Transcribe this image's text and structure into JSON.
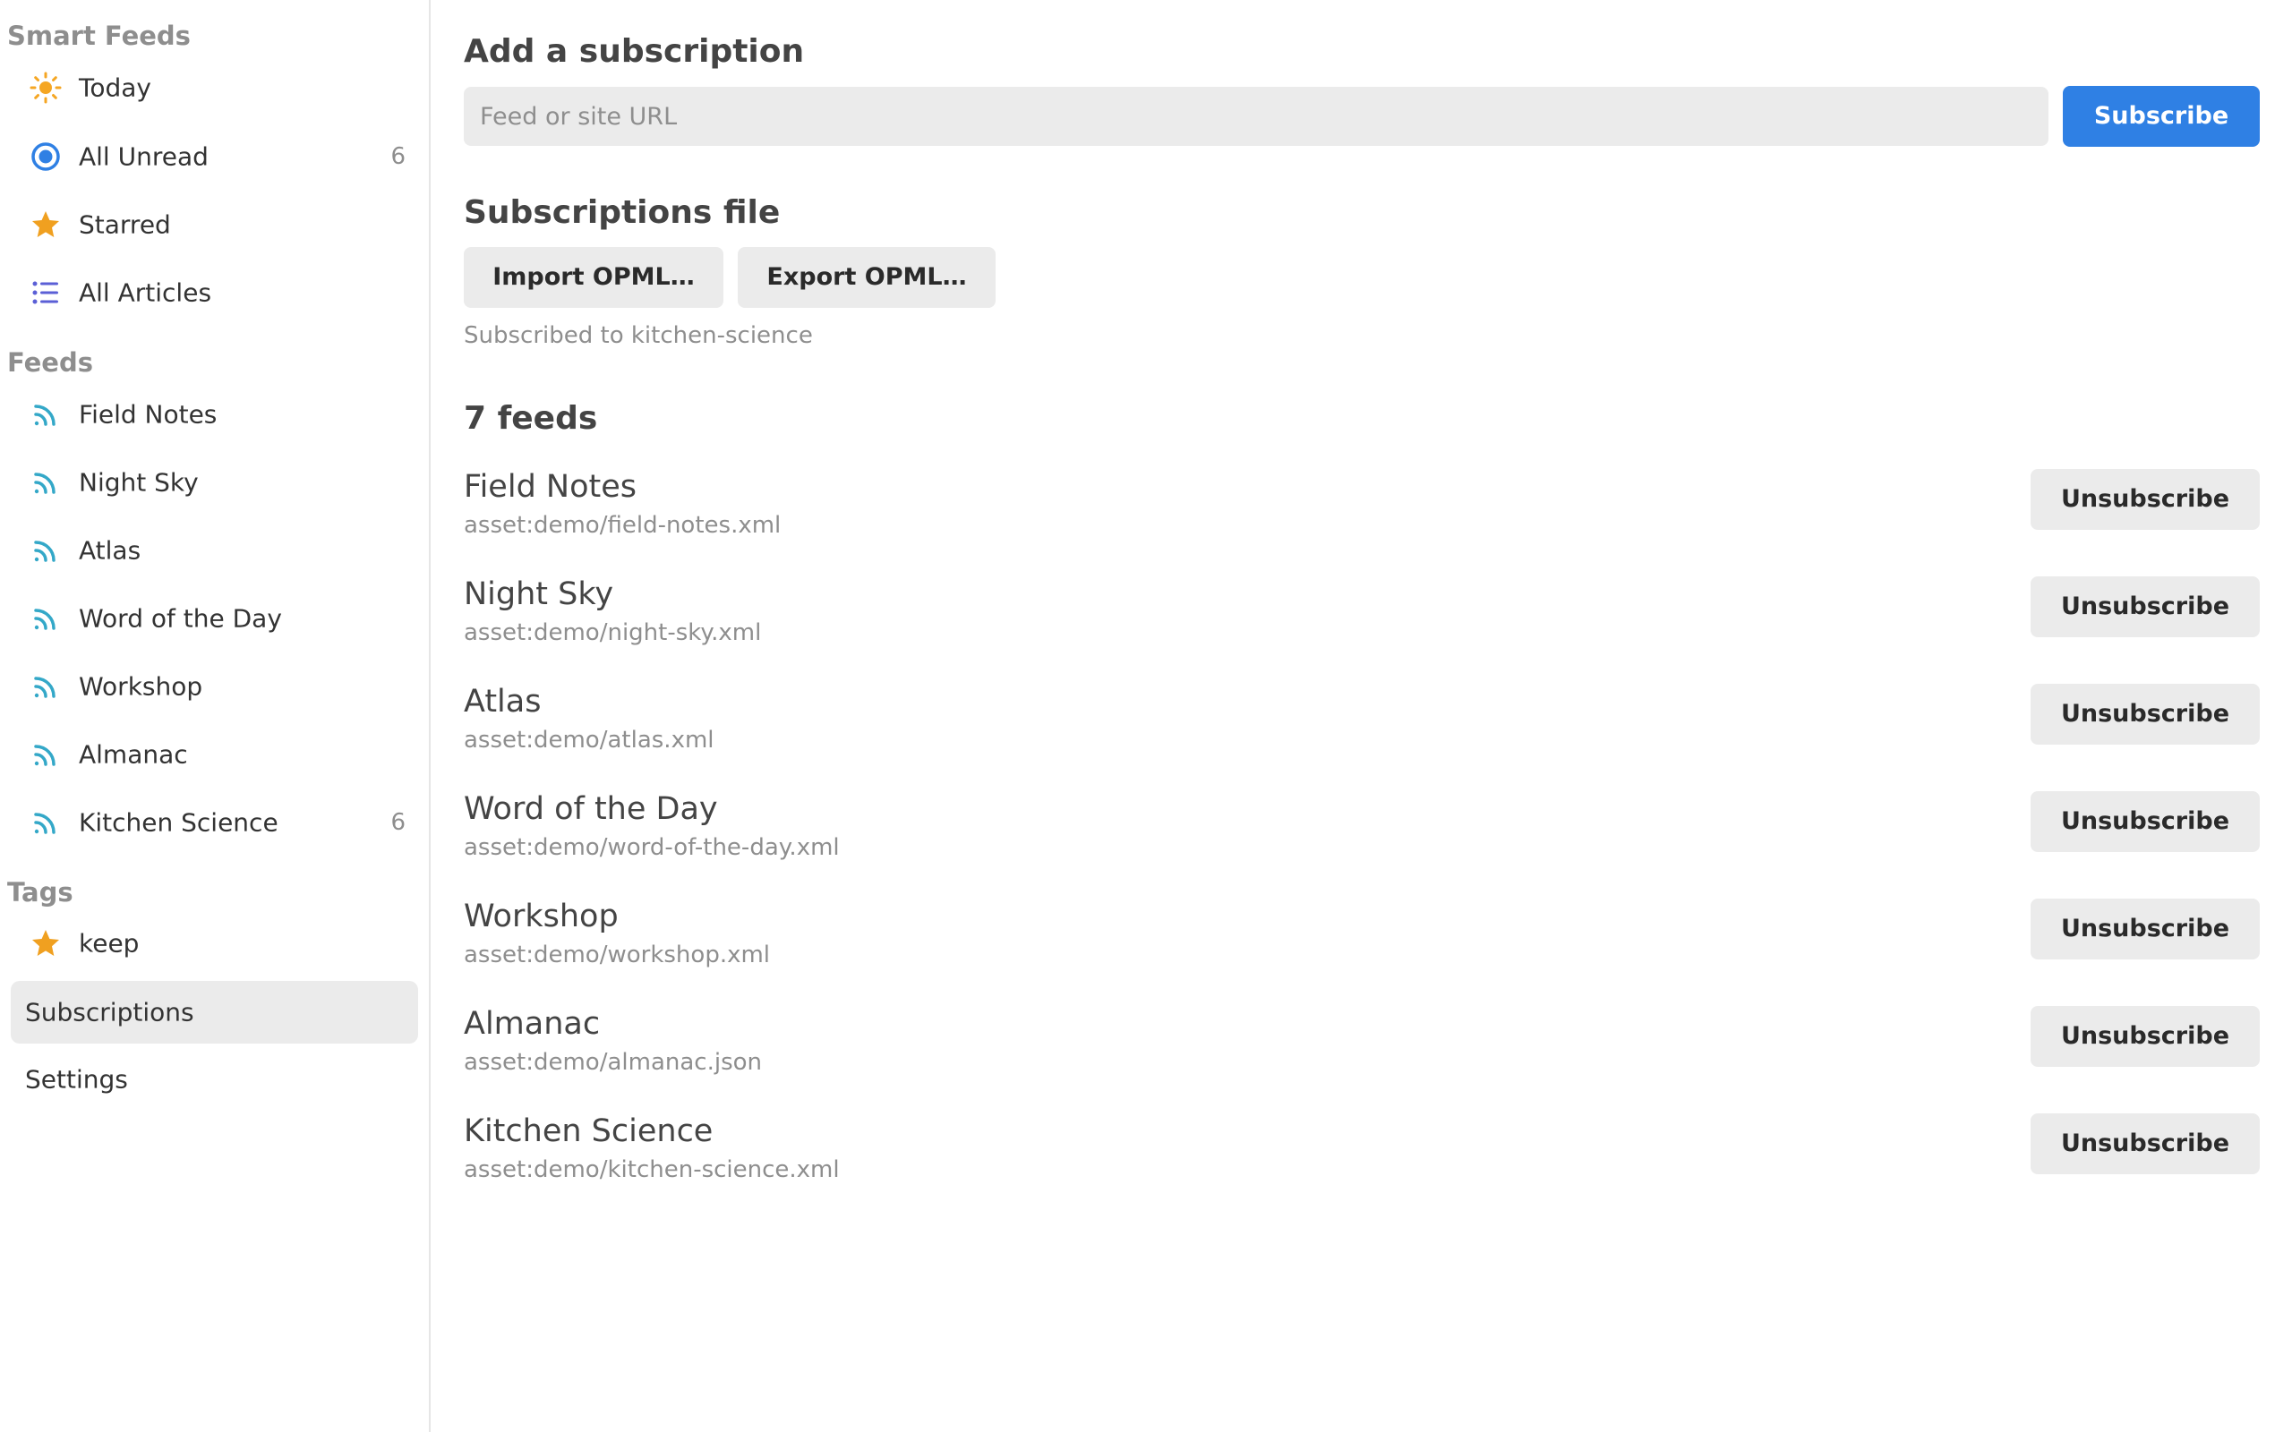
{
  "sidebar": {
    "smart_feeds_title": "Smart Feeds",
    "smart_feeds": [
      {
        "label": "Today",
        "icon": "sun-icon",
        "color": "#f5a623",
        "count": ""
      },
      {
        "label": "All Unread",
        "icon": "unread-circle-icon",
        "color": "#2f80e4",
        "count": "6"
      },
      {
        "label": "Starred",
        "icon": "star-icon",
        "color": "#f0a020",
        "count": ""
      },
      {
        "label": "All Articles",
        "icon": "list-icon",
        "color": "#5b5fd6",
        "count": ""
      }
    ],
    "feeds_title": "Feeds",
    "feeds": [
      {
        "label": "Field Notes",
        "icon": "rss-icon",
        "count": ""
      },
      {
        "label": "Night Sky",
        "icon": "rss-icon",
        "count": ""
      },
      {
        "label": "Atlas",
        "icon": "rss-icon",
        "count": ""
      },
      {
        "label": "Word of the Day",
        "icon": "rss-icon",
        "count": ""
      },
      {
        "label": "Workshop",
        "icon": "rss-icon",
        "count": ""
      },
      {
        "label": "Almanac",
        "icon": "rss-icon",
        "count": ""
      },
      {
        "label": "Kitchen Science",
        "icon": "rss-icon",
        "count": "6"
      }
    ],
    "rss_color": "#34a8c8",
    "tags_title": "Tags",
    "tags": [
      {
        "label": "keep",
        "icon": "star-icon",
        "color": "#f0a020"
      }
    ],
    "subscriptions_label": "Subscriptions",
    "settings_label": "Settings"
  },
  "main": {
    "add_title": "Add a subscription",
    "url_placeholder": "Feed or site URL",
    "url_value": "",
    "subscribe_label": "Subscribe",
    "file_title": "Subscriptions file",
    "import_label": "Import OPML…",
    "export_label": "Export OPML…",
    "status_message": "Subscribed to kitchen-science",
    "feeds_count_title": "7 feeds",
    "unsubscribe_label": "Unsubscribe",
    "feeds": [
      {
        "title": "Field Notes",
        "url": "asset:demo/field-notes.xml"
      },
      {
        "title": "Night Sky",
        "url": "asset:demo/night-sky.xml"
      },
      {
        "title": "Atlas",
        "url": "asset:demo/atlas.xml"
      },
      {
        "title": "Word of the Day",
        "url": "asset:demo/word-of-the-day.xml"
      },
      {
        "title": "Workshop",
        "url": "asset:demo/workshop.xml"
      },
      {
        "title": "Almanac",
        "url": "asset:demo/almanac.json"
      },
      {
        "title": "Kitchen Science",
        "url": "asset:demo/kitchen-science.xml"
      }
    ]
  },
  "colors": {
    "accent": "#2f80e4",
    "button_secondary": "#ebebeb",
    "muted_text": "#8e8e8e"
  }
}
